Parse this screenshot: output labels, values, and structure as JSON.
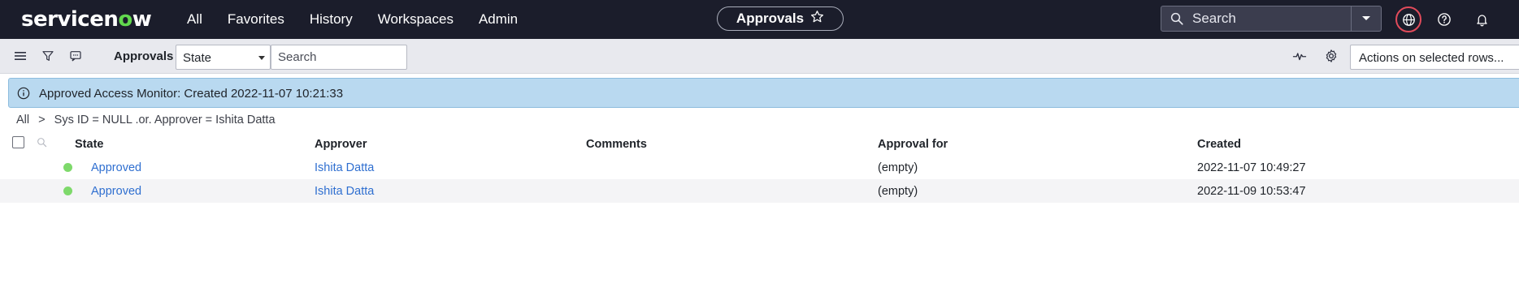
{
  "topnav": {
    "logo_text_pre": "servicen",
    "logo_text_o": "o",
    "logo_text_post": "w",
    "links": [
      "All",
      "Favorites",
      "History",
      "Workspaces",
      "Admin"
    ],
    "center_title": "Approvals",
    "search_placeholder": "Search",
    "bg_color": "#1b1d2b",
    "accent_green": "#62d84e"
  },
  "toolbar": {
    "title": "Approvals",
    "filter_field": "State",
    "search_placeholder": "Search",
    "actions_label": "Actions on selected rows..."
  },
  "banner": {
    "message": "Approved Access Monitor: Created 2022-11-07 10:21:33"
  },
  "breadcrumb": {
    "items": [
      "All",
      ">",
      "Sys ID = NULL .or. Approver = Ishita Datta"
    ]
  },
  "table": {
    "columns": [
      "State",
      "Approver",
      "Comments",
      "Approval for",
      "Created"
    ],
    "rows": [
      {
        "state": "Approved",
        "approver": "Ishita Datta",
        "comments": "",
        "approval_for": "(empty)",
        "created": "2022-11-07 10:49:27"
      },
      {
        "state": "Approved",
        "approver": "Ishita Datta",
        "comments": "",
        "approval_for": "(empty)",
        "created": "2022-11-09 10:53:47"
      }
    ],
    "status_color": "#7ed96b",
    "link_color": "#2f6fd0",
    "alt_row_color": "#f4f4f6"
  }
}
